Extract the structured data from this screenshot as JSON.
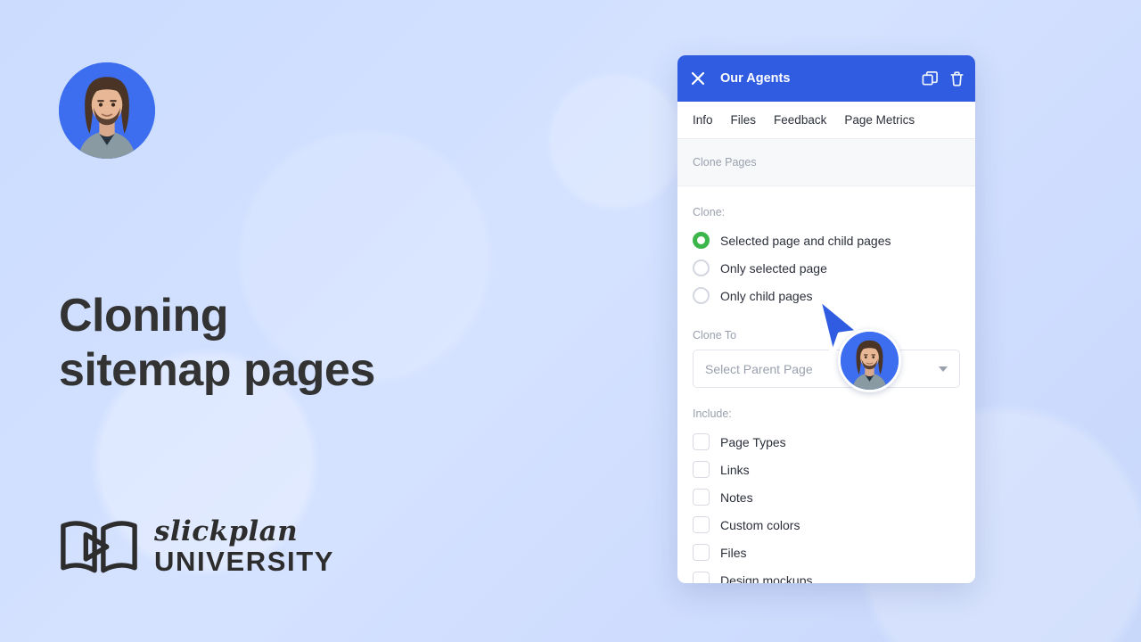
{
  "background": {
    "gradient_from": "#cbdcff",
    "gradient_to": "#c7d8fb"
  },
  "headline": {
    "line1": "Cloning",
    "line2": "sitemap pages"
  },
  "logo": {
    "mark_icon": "open-book-play-icon",
    "script_text": "slickplan",
    "wordmark": "UNIVERSITY"
  },
  "presenter": {
    "avatar_icon": "presenter-avatar",
    "avatar_bg": "#3e6ef0"
  },
  "cursor": {
    "icon": "arrow-pointer-cursor",
    "color": "#2f5ce0"
  },
  "panel": {
    "header": {
      "close_icon": "close-icon",
      "title": "Our Agents",
      "duplicate_icon": "duplicate-icon",
      "delete_icon": "trash-icon",
      "background": "#2f5ce0"
    },
    "tabs": [
      {
        "label": "Info"
      },
      {
        "label": "Files"
      },
      {
        "label": "Feedback"
      },
      {
        "label": "Page Metrics"
      }
    ],
    "section_band": {
      "label": "Clone Pages"
    },
    "clone": {
      "label": "Clone:",
      "options": [
        {
          "label": "Selected page and child pages",
          "selected": true
        },
        {
          "label": "Only selected page",
          "selected": false
        },
        {
          "label": "Only child pages",
          "selected": false
        }
      ],
      "selected_color": "#3cb54a"
    },
    "clone_to": {
      "label": "Clone To",
      "placeholder": "Select Parent Page",
      "value": "",
      "caret_icon": "chevron-down-icon"
    },
    "include": {
      "label": "Include:",
      "options": [
        {
          "label": "Page Types",
          "checked": false
        },
        {
          "label": "Links",
          "checked": false
        },
        {
          "label": "Notes",
          "checked": false
        },
        {
          "label": "Custom colors",
          "checked": false
        },
        {
          "label": "Files",
          "checked": false
        },
        {
          "label": "Design mockups",
          "checked": false
        }
      ]
    }
  }
}
